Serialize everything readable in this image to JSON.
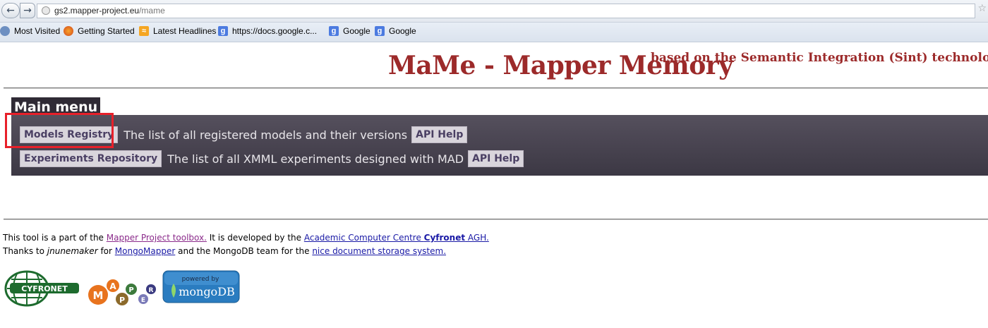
{
  "browser": {
    "url_domain": "gs2.mapper-project.eu",
    "url_path": "/mame",
    "bookmarks": [
      {
        "label": "Most Visited",
        "icon": "most-visited-icon"
      },
      {
        "label": "Getting Started",
        "icon": "firefox-icon"
      },
      {
        "label": "Latest Headlines",
        "icon": "rss-icon"
      },
      {
        "label": "https://docs.google.c...",
        "icon": "google-icon"
      },
      {
        "label": "Google",
        "icon": "google-icon"
      },
      {
        "label": "Google",
        "icon": "google-icon"
      }
    ]
  },
  "header": {
    "title": "MaMe - Mapper Memory",
    "subtitle": "based on the Semantic Integration (Sint) technology"
  },
  "menu": {
    "heading": "Main menu",
    "items": [
      {
        "button": "Models Registry",
        "description": "The list of all registered models and their versions",
        "help": "API Help"
      },
      {
        "button": "Experiments Repository",
        "description": "The list of all XMML experiments designed with MAD",
        "help": "API Help"
      }
    ]
  },
  "footer": {
    "line1": {
      "t1": "This tool is a part of the ",
      "link1": "Mapper Project toolbox.",
      "t2": " It is developed by the ",
      "link2a": "Academic Computer Centre ",
      "link2b": "Cyfronet",
      "link2c": " AGH."
    },
    "line2": {
      "t1": "Thanks to ",
      "author": "jnunemaker",
      "t2": " for ",
      "link1": "MongoMapper",
      "t3": " and the MongoDB team for the ",
      "link2": "nice document storage system."
    }
  },
  "logos": {
    "cyfronet": "CYFRONET",
    "mapper_letters": [
      "M",
      "A",
      "P",
      "P",
      "E",
      "R"
    ],
    "mongo_top": "powered by",
    "mongo_main": "mongoDB"
  },
  "colors": {
    "title": "#9c2a2a",
    "menu_panel": "#4a4552",
    "button_text": "#4a3f63",
    "highlight": "#e8202a"
  }
}
